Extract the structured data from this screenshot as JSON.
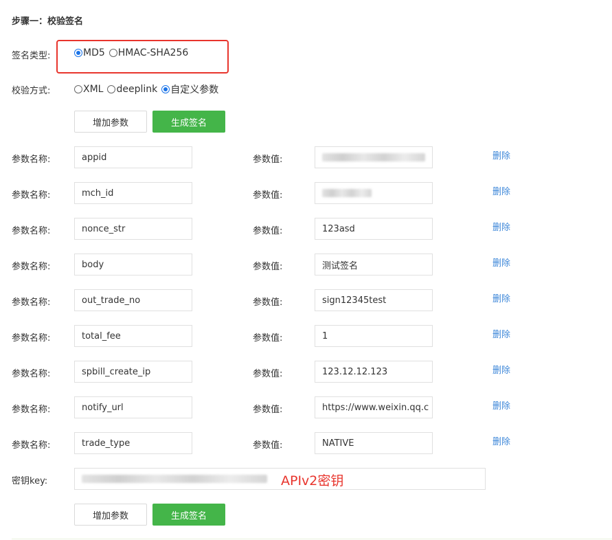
{
  "step": {
    "title": "步骤一：校验签名"
  },
  "sign_type": {
    "label": "签名类型:",
    "options": [
      {
        "label": "MD5",
        "checked": true
      },
      {
        "label": "HMAC-SHA256",
        "checked": false
      }
    ]
  },
  "verify_method": {
    "label": "校验方式:",
    "options": [
      {
        "label": "XML",
        "checked": false
      },
      {
        "label": "deeplink",
        "checked": false
      },
      {
        "label": "自定义参数",
        "checked": true
      }
    ]
  },
  "buttons": {
    "add_param": "增加参数",
    "generate_sign": "生成签名"
  },
  "params": {
    "name_label": "参数名称:",
    "value_label": "参数值:",
    "delete_label": "删除",
    "rows": [
      {
        "name": "appid",
        "value": "",
        "redacted": true
      },
      {
        "name": "mch_id",
        "value": "",
        "redacted": true
      },
      {
        "name": "nonce_str",
        "value": "123asd",
        "redacted": false
      },
      {
        "name": "body",
        "value": "测试签名",
        "redacted": false
      },
      {
        "name": "out_trade_no",
        "value": "sign12345test",
        "redacted": false
      },
      {
        "name": "total_fee",
        "value": "1",
        "redacted": false
      },
      {
        "name": "spbill_create_ip",
        "value": "123.12.12.123",
        "redacted": false
      },
      {
        "name": "notify_url",
        "value": "https://www.weixin.qq.c",
        "redacted": false
      },
      {
        "name": "trade_type",
        "value": "NATIVE",
        "redacted": false
      }
    ]
  },
  "key": {
    "label": "密钥key:",
    "annotation": "APIv2密钥"
  },
  "colors": {
    "primary": "#44b549",
    "link": "#3f88d9",
    "highlight": "#e8342c",
    "radio_checked": "#1a73e8"
  }
}
